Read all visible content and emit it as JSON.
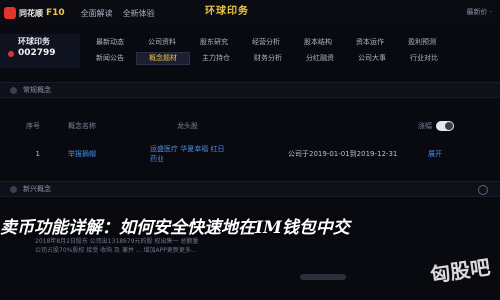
{
  "header": {
    "brand": "同花顺",
    "brand_f10": "F10",
    "menu": [
      "全面解读",
      "全新体验"
    ],
    "center_title": "环球印务",
    "version_tag": "最新价 ·"
  },
  "stock": {
    "name": "环球印务",
    "code": "002799"
  },
  "tabs": {
    "row1": [
      "最新动态",
      "公司资料",
      "股东研究",
      "经营分析",
      "股本结构",
      "资本运作",
      "盈利预测"
    ],
    "row2": [
      "新闻公告",
      "概念题材",
      "主力持仓",
      "财务分析",
      "分红融资",
      "公司大事",
      "行业对比"
    ],
    "active": "概念题材"
  },
  "section1": {
    "title": "常规概念"
  },
  "table": {
    "headers": [
      "序号",
      "概念名称",
      "龙头股",
      "",
      "涨幅"
    ],
    "rows": [
      {
        "index": "1",
        "concept": "举报摘帽",
        "stocks": "运盛医疗 华夏幸福 红日药业",
        "date": "公司于2019-01-01到2019-12-31",
        "action": "展开"
      }
    ]
  },
  "section2": {
    "title": "新兴概念"
  },
  "overlay": {
    "title": "卖币功能详解：如何安全快速地在IM钱包中交"
  },
  "news": {
    "line1": "2018年8月2日股东 公司出1318679元的股 权出售一 总额量",
    "line2": "公司占股70%股权 接受 收购 及 兼并 ... 增加APP更新更多..."
  },
  "watermark": "匈股吧"
}
